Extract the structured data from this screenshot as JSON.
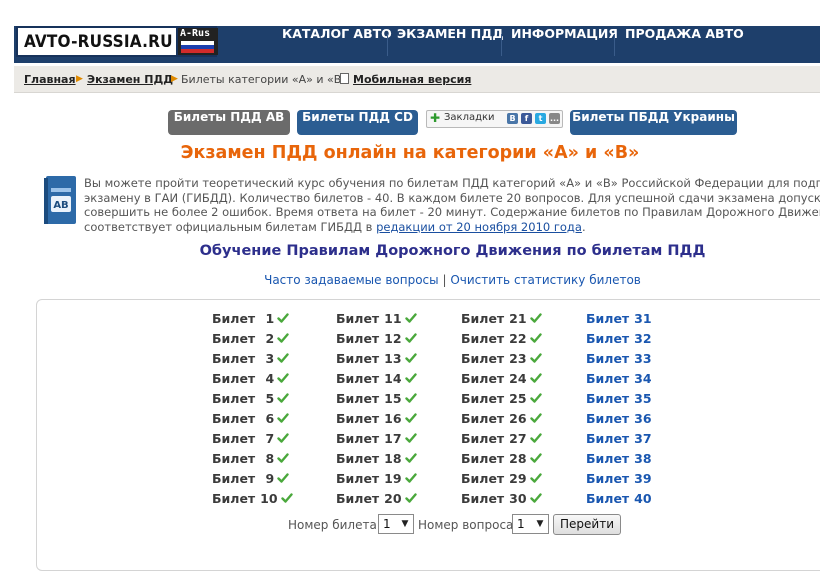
{
  "logo": {
    "text": "AVTO-RUSSIA.RU",
    "badge": "A-Rus"
  },
  "nav": [
    "КАТАЛОГ АВТО",
    "ЭКЗАМЕН ПДД",
    "ИНФОРМАЦИЯ",
    "ПРОДАЖА АВТО"
  ],
  "breadcrumb": {
    "home": "Главная",
    "exam": "Экзамен ПДД",
    "current": "Билеты категории «А» и «В»",
    "mobile": "Мобильная версия"
  },
  "tabs": [
    "Билеты ПДД АВ",
    "Билеты ПДД CD",
    "Билеты ПБДД Украины"
  ],
  "bookmarks": {
    "label": "Закладки",
    "icons": [
      "В",
      "f",
      "t",
      "..."
    ]
  },
  "title": "Экзамен ПДД онлайн на категории «А» и «В»",
  "intro": {
    "line1": "Вы можете пройти теоретический курс обучения по билетам ПДД категорий «А» и «В» Российской Федерации для подготовки",
    "line2": "экзамену в ГАИ (ГИБДД). Количество билетов - 40. В каждом билете 20 вопросов. Для успешной сдачи экзамена допускается",
    "line3": "совершить не более 2 ошибок. Время ответа на билет - 20 минут. Содержание билетов по Правилам Дорожного Движения полностью",
    "line4_pre": "соответствует официальным билетам ГИБДД в ",
    "line4_link": "редакции от 20 ноября 2010 года",
    "line4_post": "."
  },
  "subtitle": "Обучение Правилам Дорожного Движения по билетам ПДД",
  "links": {
    "faq": "Часто задаваемые вопросы",
    "sep": "|",
    "clear": "Очистить статистику билетов"
  },
  "ticket_label": "Билет",
  "tickets": [
    {
      "n": "1",
      "done": true
    },
    {
      "n": "2",
      "done": true
    },
    {
      "n": "3",
      "done": true
    },
    {
      "n": "4",
      "done": true
    },
    {
      "n": "5",
      "done": true
    },
    {
      "n": "6",
      "done": true
    },
    {
      "n": "7",
      "done": true
    },
    {
      "n": "8",
      "done": true
    },
    {
      "n": "9",
      "done": true
    },
    {
      "n": "10",
      "done": true
    },
    {
      "n": "11",
      "done": true
    },
    {
      "n": "12",
      "done": true
    },
    {
      "n": "13",
      "done": true
    },
    {
      "n": "14",
      "done": true
    },
    {
      "n": "15",
      "done": true
    },
    {
      "n": "16",
      "done": true
    },
    {
      "n": "17",
      "done": true
    },
    {
      "n": "18",
      "done": true
    },
    {
      "n": "19",
      "done": true
    },
    {
      "n": "20",
      "done": true
    },
    {
      "n": "21",
      "done": true
    },
    {
      "n": "22",
      "done": true
    },
    {
      "n": "23",
      "done": true
    },
    {
      "n": "24",
      "done": true
    },
    {
      "n": "25",
      "done": true
    },
    {
      "n": "26",
      "done": true
    },
    {
      "n": "27",
      "done": true
    },
    {
      "n": "28",
      "done": true
    },
    {
      "n": "29",
      "done": true
    },
    {
      "n": "30",
      "done": true
    },
    {
      "n": "31",
      "done": false
    },
    {
      "n": "32",
      "done": false
    },
    {
      "n": "33",
      "done": false
    },
    {
      "n": "34",
      "done": false
    },
    {
      "n": "35",
      "done": false
    },
    {
      "n": "36",
      "done": false
    },
    {
      "n": "37",
      "done": false
    },
    {
      "n": "38",
      "done": false
    },
    {
      "n": "39",
      "done": false
    },
    {
      "n": "40",
      "done": false
    }
  ],
  "form": {
    "ticket_label": "Номер билета:",
    "ticket_value": "1",
    "question_label": "Номер вопроса:",
    "question_value": "1",
    "go": "Перейти"
  },
  "colors": {
    "nav": "#1e3f6b",
    "tab_grey": "#6b6b6b",
    "tab_blue": "#2b5d92",
    "title": "#e8650a",
    "link": "#1a57b0",
    "check": "#4aa83c"
  }
}
